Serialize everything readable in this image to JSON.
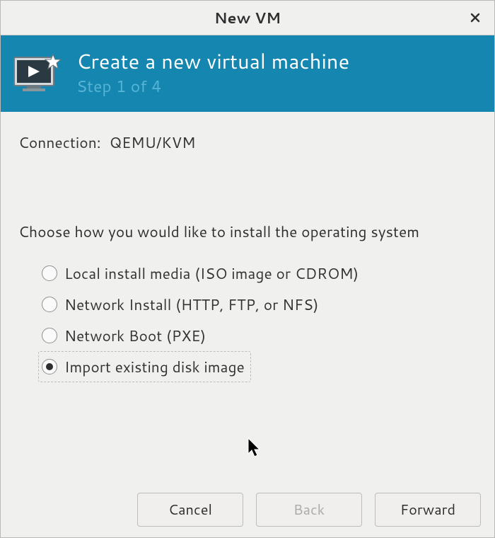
{
  "window": {
    "title": "New VM"
  },
  "header": {
    "title": "Create a new virtual machine",
    "step_label": "Step 1 of 4"
  },
  "connection": {
    "label": "Connection:",
    "value": "QEMU/KVM"
  },
  "install": {
    "prompt": "Choose how you would like to install the operating system",
    "options": [
      {
        "id": "local-media",
        "label": "Local install media (ISO image or CDROM)",
        "selected": false
      },
      {
        "id": "network-install",
        "label": "Network Install (HTTP, FTP, or NFS)",
        "selected": false
      },
      {
        "id": "network-boot",
        "label": "Network Boot (PXE)",
        "selected": false
      },
      {
        "id": "import-disk",
        "label": "Import existing disk image",
        "selected": true
      }
    ]
  },
  "buttons": {
    "cancel": "Cancel",
    "back": "Back",
    "forward": "Forward",
    "back_enabled": false
  }
}
